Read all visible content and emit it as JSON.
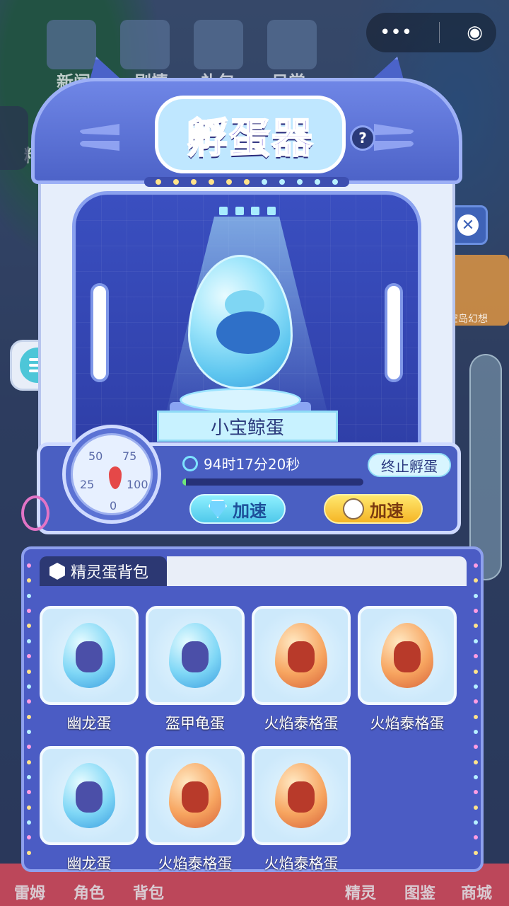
{
  "top_capsule": {
    "more": "•••",
    "record": "◉"
  },
  "bg_labels": [
    "新闻",
    "剧情",
    "礼包",
    "日常",
    "精"
  ],
  "side": {
    "map_label": "空岛幻想",
    "close": "✕"
  },
  "bottom_nav": [
    "雷姆",
    "角色",
    "背包",
    "精灵",
    "图鉴",
    "商城"
  ],
  "incubator": {
    "title": "孵蛋器",
    "help": "?",
    "current_egg": "小宝鲸蛋",
    "timer": "94时17分20秒",
    "stop_button": "终止孵蛋",
    "progress": 0.02,
    "gauge_ticks": [
      "25",
      "50",
      "75",
      "100",
      "0"
    ],
    "speed_button_gem": "加速",
    "speed_button_friend": "加速"
  },
  "backpack": {
    "tab": "精灵蛋背包",
    "eggs": [
      {
        "name": "幽龙蛋",
        "type": "blue"
      },
      {
        "name": "盔甲龟蛋",
        "type": "blue"
      },
      {
        "name": "火焰泰格蛋",
        "type": "fire"
      },
      {
        "name": "火焰泰格蛋",
        "type": "fire"
      },
      {
        "name": "幽龙蛋",
        "type": "blue"
      },
      {
        "name": "火焰泰格蛋",
        "type": "fire"
      },
      {
        "name": "火焰泰格蛋",
        "type": "fire"
      }
    ]
  }
}
